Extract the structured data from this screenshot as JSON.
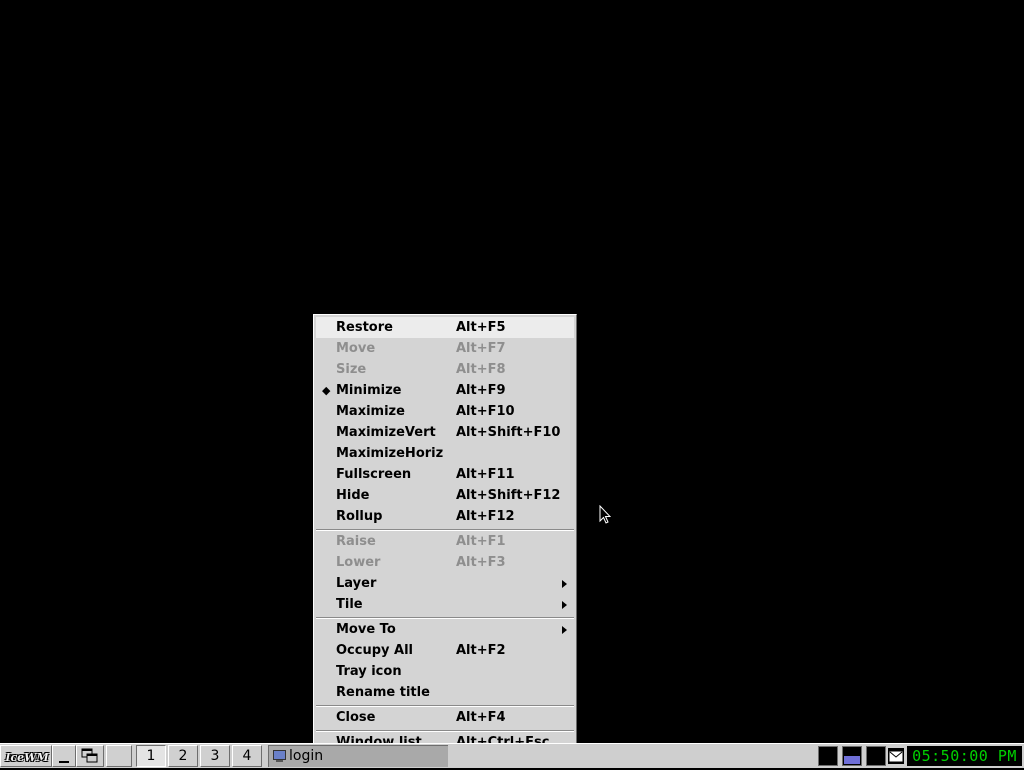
{
  "menu": {
    "items": [
      {
        "label": "Restore",
        "accel": "Alt+F5"
      },
      {
        "label": "Move",
        "accel": "Alt+F7"
      },
      {
        "label": "Size",
        "accel": "Alt+F8"
      },
      {
        "label": "Minimize",
        "accel": "Alt+F9",
        "check": "◆"
      },
      {
        "label": "Maximize",
        "accel": "Alt+F10"
      },
      {
        "label": "MaximizeVert",
        "accel": "Alt+Shift+F10"
      },
      {
        "label": "MaximizeHoriz",
        "accel": ""
      },
      {
        "label": "Fullscreen",
        "accel": "Alt+F11"
      },
      {
        "label": "Hide",
        "accel": "Alt+Shift+F12"
      },
      {
        "label": "Rollup",
        "accel": "Alt+F12"
      },
      {
        "label": "Raise",
        "accel": "Alt+F1"
      },
      {
        "label": "Lower",
        "accel": "Alt+F3"
      },
      {
        "label": "Layer",
        "accel": ""
      },
      {
        "label": "Tile",
        "accel": ""
      },
      {
        "label": "Move To",
        "accel": ""
      },
      {
        "label": "Occupy All",
        "accel": "Alt+F2"
      },
      {
        "label": "Tray icon",
        "accel": ""
      },
      {
        "label": "Rename title",
        "accel": ""
      },
      {
        "label": "Close",
        "accel": "Alt+F4"
      },
      {
        "label": "Window list",
        "accel": "Alt+Ctrl+Esc"
      }
    ]
  },
  "taskbar": {
    "start_logo": "IceWM",
    "workspaces": [
      "1",
      "2",
      "3",
      "4"
    ],
    "task_title": "login",
    "clock": "05:50:00 PM"
  },
  "colors": {
    "desktop": "#000000",
    "menu_bg": "#d4d4d4",
    "disabled_text": "#8e8e8e",
    "clock_text": "#00d000",
    "cpu_graph": "#7070d8"
  }
}
